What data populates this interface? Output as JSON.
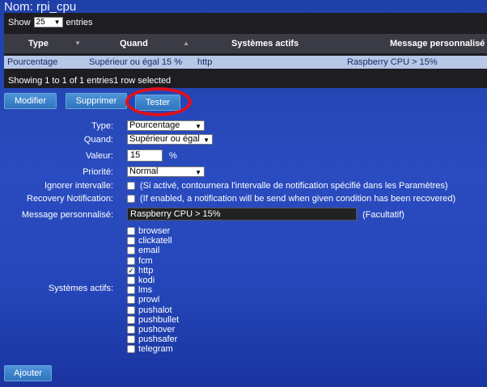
{
  "page": {
    "title": "Nom: rpi_cpu"
  },
  "table": {
    "show_label": "Show",
    "page_size": "25",
    "entries_label": "entries",
    "columns": [
      "Type",
      "Quand",
      "Systèmes actifs",
      "Message personnalisé"
    ],
    "rows": [
      [
        "Pourcentage",
        "Supérieur ou égal 15 %",
        "http",
        "Raspberry CPU > 15%"
      ]
    ],
    "info": "Showing 1 to 1 of 1 entries1 row selected"
  },
  "actions": {
    "modify": "Modifier",
    "delete": "Supprimer",
    "test": "Tester"
  },
  "form": {
    "type_label": "Type:",
    "type_value": "Pourcentage",
    "when_label": "Quand:",
    "when_value": "Supérieur ou égal",
    "value_label": "Valeur:",
    "value_value": "15",
    "value_unit": "%",
    "priority_label": "Priorité:",
    "priority_value": "Normal",
    "ignore_label": "Ignorer intervalle:",
    "ignore_text": "(Si activé, contournera l'intervalle de notification spécifié dans les Paramètres)",
    "recovery_label": "Recovery Notification:",
    "recovery_text": "(If enabled, a notification will be send when given condition has been recovered)",
    "message_label": "Message personnalisé:",
    "message_value": "Raspberry CPU > 15%",
    "message_hint": "(Facultatif)",
    "systems_label": "Systèmes actifs:",
    "systems": [
      {
        "name": "browser",
        "checked": false
      },
      {
        "name": "clickatell",
        "checked": false
      },
      {
        "name": "email",
        "checked": false
      },
      {
        "name": "fcm",
        "checked": false
      },
      {
        "name": "http",
        "checked": true
      },
      {
        "name": "kodi",
        "checked": false
      },
      {
        "name": "lms",
        "checked": false
      },
      {
        "name": "prowl",
        "checked": false
      },
      {
        "name": "pushalot",
        "checked": false
      },
      {
        "name": "pushbullet",
        "checked": false
      },
      {
        "name": "pushover",
        "checked": false
      },
      {
        "name": "pushsafer",
        "checked": false
      },
      {
        "name": "telegram",
        "checked": false
      }
    ],
    "add_label": "Ajouter"
  },
  "colors": {
    "highlight_ring": "#e0101c",
    "selected_row": "#b7c8e6",
    "button": "#3a82c9"
  }
}
